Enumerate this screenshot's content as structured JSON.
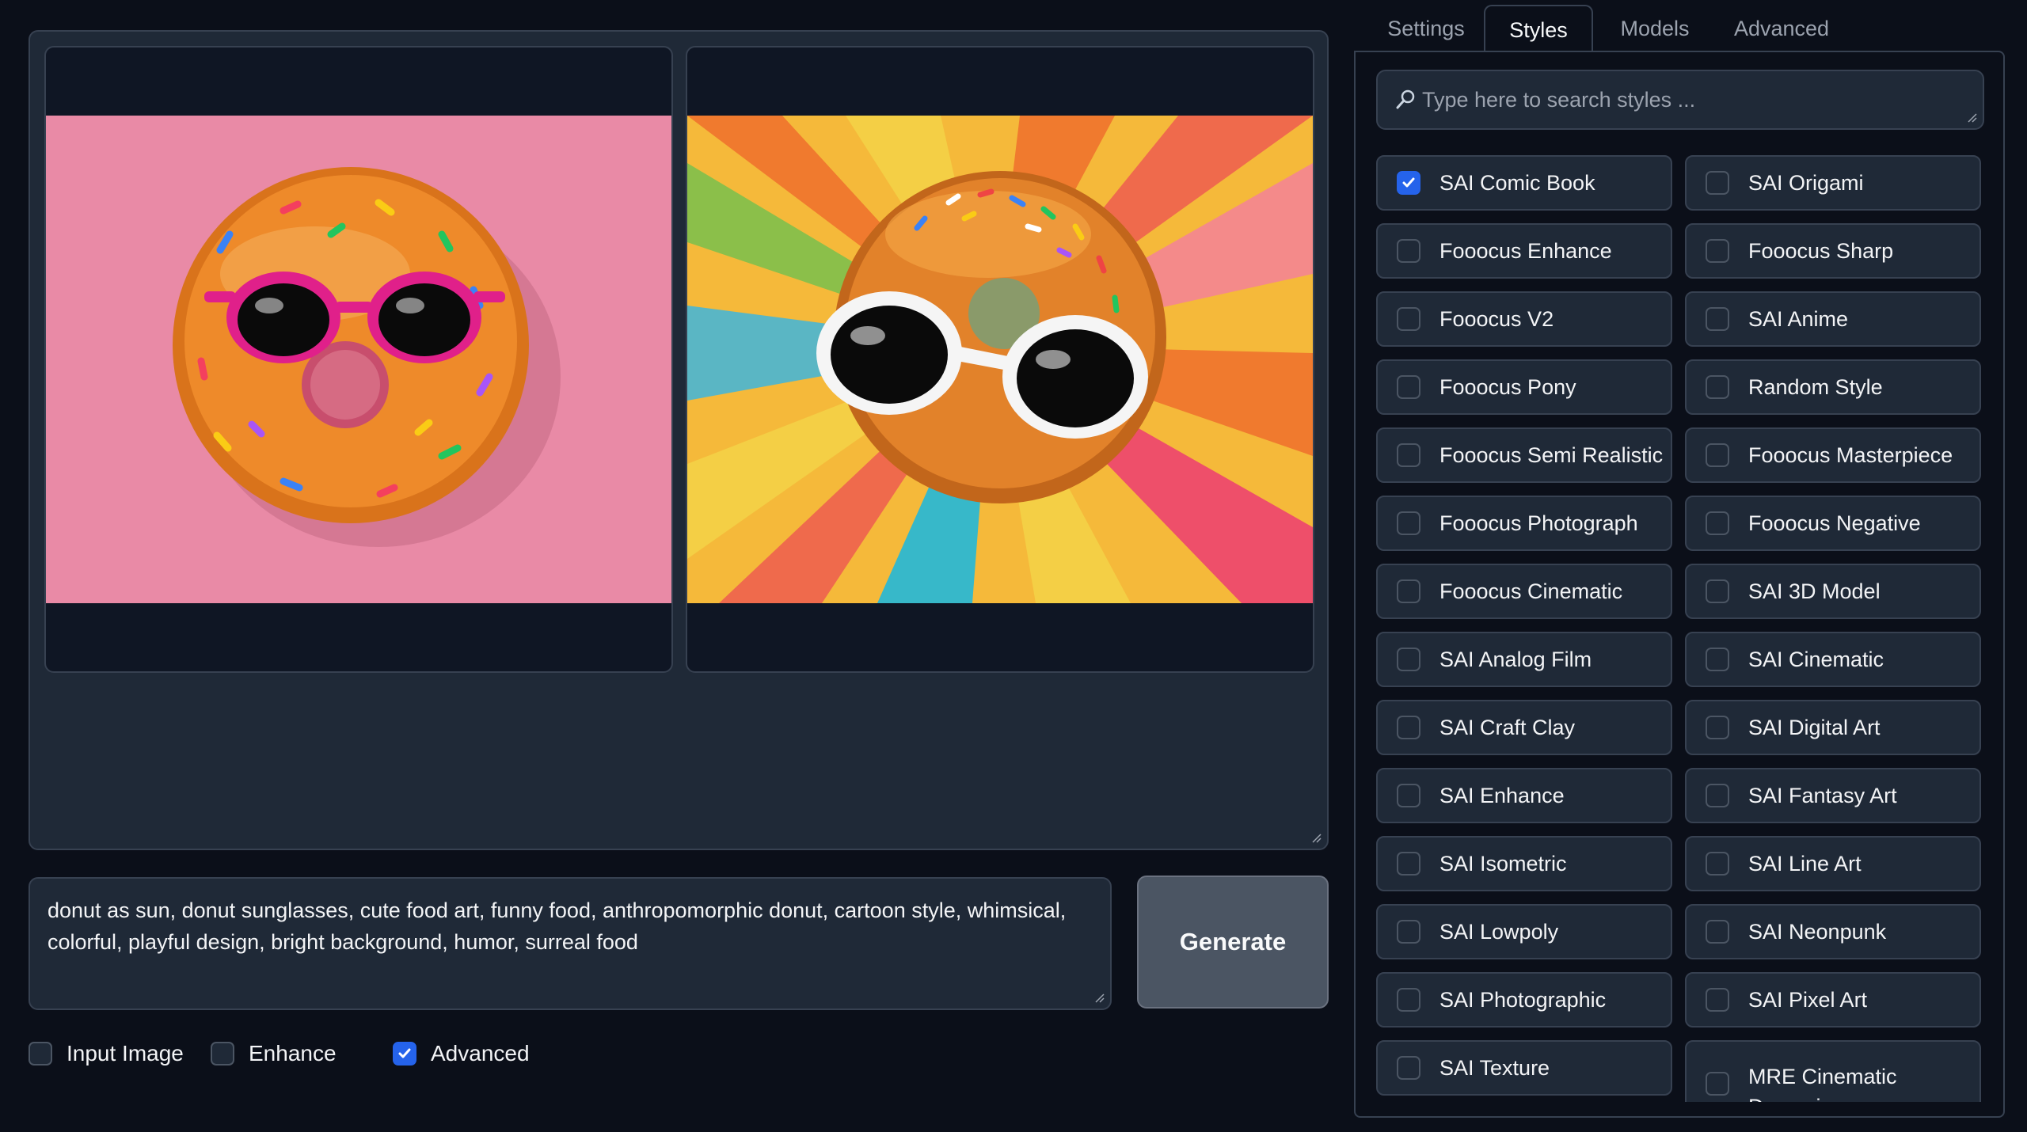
{
  "gallery": {
    "images": [
      {
        "alt": "donut-pink"
      },
      {
        "alt": "donut-sunburst"
      }
    ]
  },
  "prompt": {
    "text": "donut as sun, donut sunglasses, cute food art, funny food, anthropomorphic donut, cartoon style, whimsical, colorful, playful design, bright background, humor, surreal food"
  },
  "generate_label": "Generate",
  "options": [
    {
      "label": "Input Image",
      "checked": false
    },
    {
      "label": "Enhance",
      "checked": false
    },
    {
      "label": "Advanced",
      "checked": true
    }
  ],
  "tabs": [
    {
      "label": "Settings",
      "active": false
    },
    {
      "label": "Styles",
      "active": true
    },
    {
      "label": "Models",
      "active": false
    },
    {
      "label": "Advanced",
      "active": false
    }
  ],
  "styles_search": {
    "placeholder": "Type here to search styles ..."
  },
  "styles": [
    {
      "label": "SAI Comic Book",
      "checked": true
    },
    {
      "label": "SAI Origami",
      "checked": false
    },
    {
      "label": "Fooocus Enhance",
      "checked": false
    },
    {
      "label": "Fooocus Sharp",
      "checked": false
    },
    {
      "label": "Fooocus V2",
      "checked": false
    },
    {
      "label": "SAI Anime",
      "checked": false
    },
    {
      "label": "Fooocus Pony",
      "checked": false
    },
    {
      "label": "Random Style",
      "checked": false
    },
    {
      "label": "Fooocus Semi Realistic",
      "checked": false
    },
    {
      "label": "Fooocus Masterpiece",
      "checked": false
    },
    {
      "label": "Fooocus Photograph",
      "checked": false
    },
    {
      "label": "Fooocus Negative",
      "checked": false
    },
    {
      "label": "Fooocus Cinematic",
      "checked": false
    },
    {
      "label": "SAI 3D Model",
      "checked": false
    },
    {
      "label": "SAI Analog Film",
      "checked": false
    },
    {
      "label": "SAI Cinematic",
      "checked": false
    },
    {
      "label": "SAI Craft Clay",
      "checked": false
    },
    {
      "label": "SAI Digital Art",
      "checked": false
    },
    {
      "label": "SAI Enhance",
      "checked": false
    },
    {
      "label": "SAI Fantasy Art",
      "checked": false
    },
    {
      "label": "SAI Isometric",
      "checked": false
    },
    {
      "label": "SAI Line Art",
      "checked": false
    },
    {
      "label": "SAI Lowpoly",
      "checked": false
    },
    {
      "label": "SAI Neonpunk",
      "checked": false
    },
    {
      "label": "SAI Photographic",
      "checked": false
    },
    {
      "label": "SAI Pixel Art",
      "checked": false
    },
    {
      "label": "SAI Texture",
      "checked": false
    },
    {
      "label": "MRE Cinematic Dynamic",
      "checked": false
    }
  ],
  "colors": {
    "accent": "#2563eb",
    "background": "#0b0f19",
    "panel": "#1f2937",
    "border": "#374151"
  }
}
